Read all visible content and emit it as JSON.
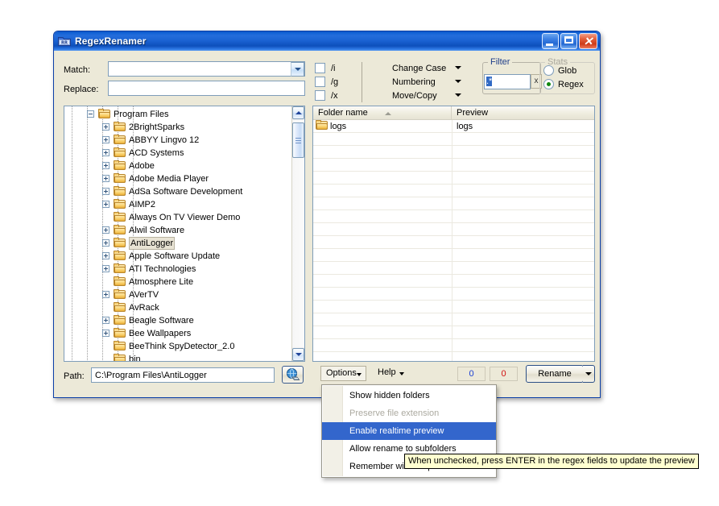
{
  "window": {
    "title": "RegexRenamer",
    "icon": "app-folder-rr-icon",
    "minimize_label": "Minimize",
    "maximize_label": "Maximize",
    "close_label": "Close"
  },
  "form": {
    "match_label": "Match:",
    "match_value": "",
    "replace_label": "Replace:",
    "replace_value": "",
    "flags": [
      {
        "label": "/i",
        "checked": false
      },
      {
        "label": "/g",
        "checked": false
      },
      {
        "label": "/x",
        "checked": false
      }
    ],
    "menus": [
      {
        "label": "Change Case"
      },
      {
        "label": "Numbering"
      },
      {
        "label": "Move/Copy"
      }
    ]
  },
  "filter": {
    "legend": "Filter",
    "value": ".*",
    "clear_label": "x"
  },
  "stats": {
    "legend": "Stats",
    "options": [
      {
        "label": "Glob",
        "selected": false
      },
      {
        "label": "Regex",
        "selected": true
      }
    ]
  },
  "tree": {
    "nodes": [
      {
        "label": "Program Files",
        "depth": 3,
        "expander": "minus",
        "selected": false
      },
      {
        "label": "2BrightSparks",
        "depth": 4,
        "expander": "plus",
        "selected": false
      },
      {
        "label": "ABBYY Lingvo 12",
        "depth": 4,
        "expander": "plus",
        "selected": false
      },
      {
        "label": "ACD Systems",
        "depth": 4,
        "expander": "plus",
        "selected": false
      },
      {
        "label": "Adobe",
        "depth": 4,
        "expander": "plus",
        "selected": false
      },
      {
        "label": "Adobe Media Player",
        "depth": 4,
        "expander": "plus",
        "selected": false
      },
      {
        "label": "AdSa Software Development",
        "depth": 4,
        "expander": "plus",
        "selected": false
      },
      {
        "label": "AIMP2",
        "depth": 4,
        "expander": "plus",
        "selected": false
      },
      {
        "label": "Always On TV Viewer Demo",
        "depth": 4,
        "expander": "none",
        "selected": false
      },
      {
        "label": "Alwil Software",
        "depth": 4,
        "expander": "plus",
        "selected": false
      },
      {
        "label": "AntiLogger",
        "depth": 4,
        "expander": "plus",
        "selected": true
      },
      {
        "label": "Apple Software Update",
        "depth": 4,
        "expander": "plus",
        "selected": false
      },
      {
        "label": "ATI Technologies",
        "depth": 4,
        "expander": "plus",
        "selected": false
      },
      {
        "label": "Atmosphere Lite",
        "depth": 4,
        "expander": "none",
        "selected": false
      },
      {
        "label": "AVerTV",
        "depth": 4,
        "expander": "plus",
        "selected": false
      },
      {
        "label": "AvRack",
        "depth": 4,
        "expander": "none",
        "selected": false
      },
      {
        "label": "Beagle Software",
        "depth": 4,
        "expander": "plus",
        "selected": false
      },
      {
        "label": "Bee Wallpapers",
        "depth": 4,
        "expander": "plus",
        "selected": false
      },
      {
        "label": "BeeThink SpyDetector_2.0",
        "depth": 4,
        "expander": "none",
        "selected": false
      },
      {
        "label": "bin",
        "depth": 4,
        "expander": "none",
        "selected": false
      }
    ]
  },
  "list": {
    "columns": [
      {
        "label": "Folder name",
        "sorted": "asc"
      },
      {
        "label": "Preview",
        "sorted": ""
      }
    ],
    "rows": [
      {
        "name": "logs",
        "preview": "logs"
      }
    ]
  },
  "bottom": {
    "path_label": "Path:",
    "path_value": "C:\\Program Files\\AntiLogger",
    "browse_icon": "globe-browse-icon",
    "options_label": "Options",
    "help_label": "Help",
    "counter_ok": "0",
    "counter_err": "0",
    "rename_label": "Rename"
  },
  "options_menu": {
    "items": [
      {
        "label": "Show hidden folders",
        "state": "normal"
      },
      {
        "label": "Preserve file extension",
        "state": "disabled"
      },
      {
        "label": "Enable realtime preview",
        "state": "highlighted"
      },
      {
        "label": "Allow rename to subfolders",
        "state": "normal"
      },
      {
        "label": "Remember window position",
        "state": "normal"
      }
    ]
  },
  "tooltip": {
    "text": "When unchecked, press ENTER in the regex fields to update the preview"
  },
  "colors": {
    "titlebar_blue": "#1a62d2",
    "menu_highlight": "#3366cc",
    "selection_blue": "#316ac5",
    "tooltip_bg": "#ffffd0",
    "counter_blue": "#1a3fd4",
    "counter_red": "#d21010",
    "window_face": "#ece9d8"
  }
}
